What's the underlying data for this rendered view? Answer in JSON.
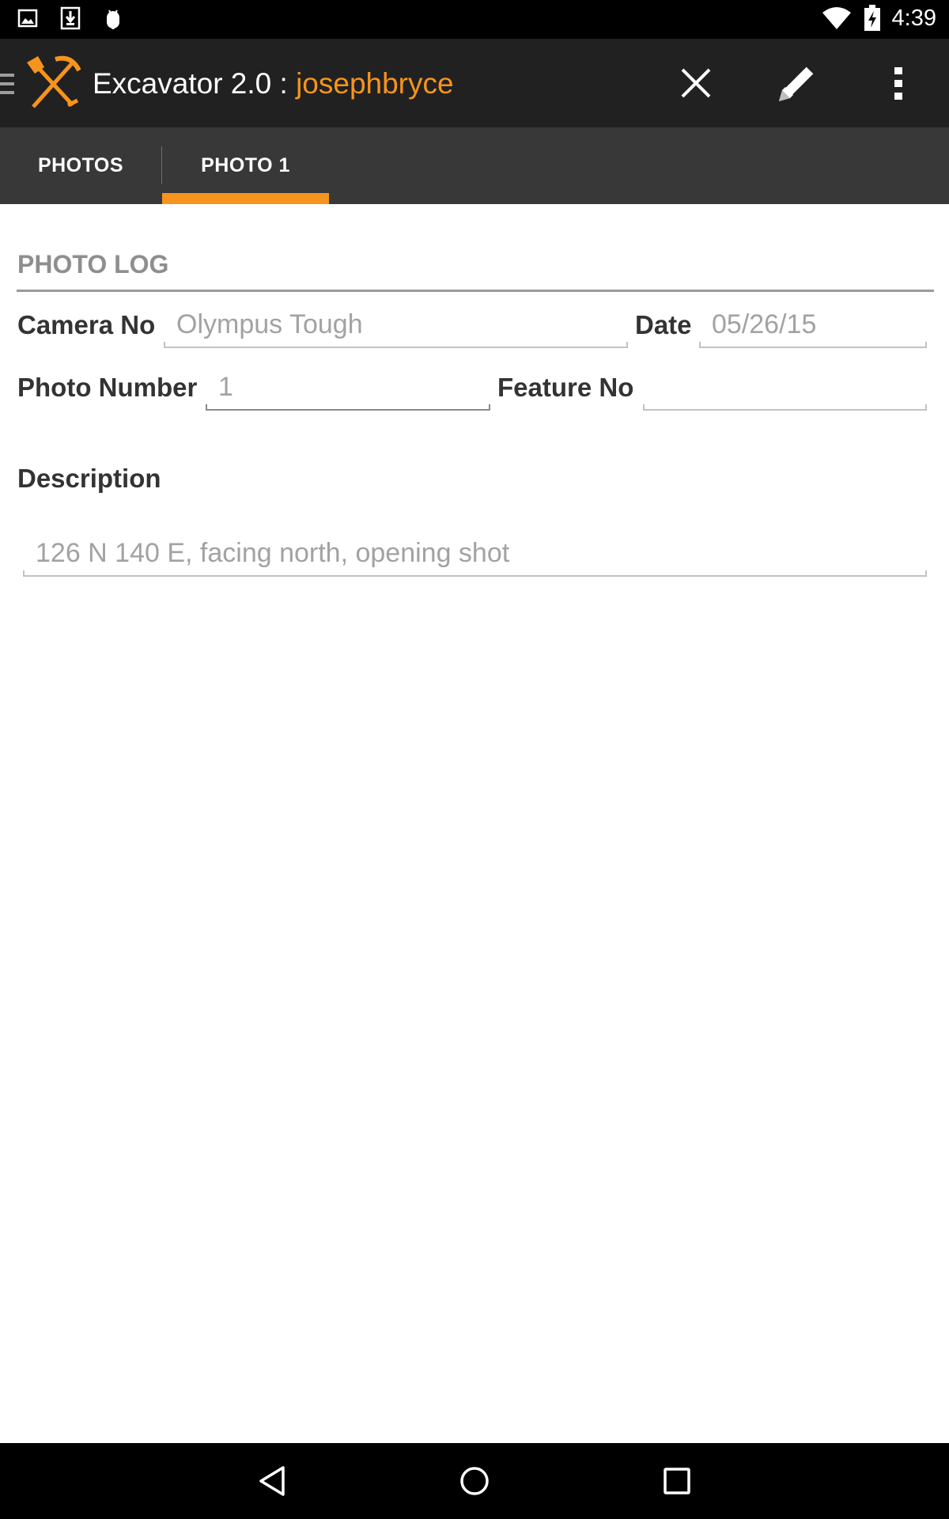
{
  "status_bar": {
    "time": "4:39",
    "icons": [
      "image-notification-icon",
      "download-icon",
      "android-debug-icon",
      "wifi-icon",
      "battery-charging-icon"
    ]
  },
  "app_bar": {
    "title": "Excavator 2.0 : ",
    "username": "josephbryce",
    "actions": [
      "close-icon",
      "pencil-icon",
      "overflow-menu-icon"
    ]
  },
  "tabs": [
    {
      "label": "PHOTOS",
      "selected": false
    },
    {
      "label": "PHOTO 1",
      "selected": true
    }
  ],
  "form": {
    "section_title": "PHOTO LOG",
    "camera_no": {
      "label": "Camera No",
      "value": "Olympus Tough"
    },
    "date": {
      "label": "Date",
      "value": "05/26/15"
    },
    "photo_number": {
      "label": "Photo Number",
      "value": "1"
    },
    "feature_no": {
      "label": "Feature No",
      "value": ""
    },
    "description": {
      "label": "Description",
      "value": "126 N 140 E, facing north, opening shot"
    }
  },
  "nav_bar": {
    "buttons": [
      "back-icon",
      "home-icon",
      "recents-icon"
    ]
  },
  "colors": {
    "accent": "#f7941d",
    "app_bar": "#212121",
    "tab_bar": "#383838"
  }
}
